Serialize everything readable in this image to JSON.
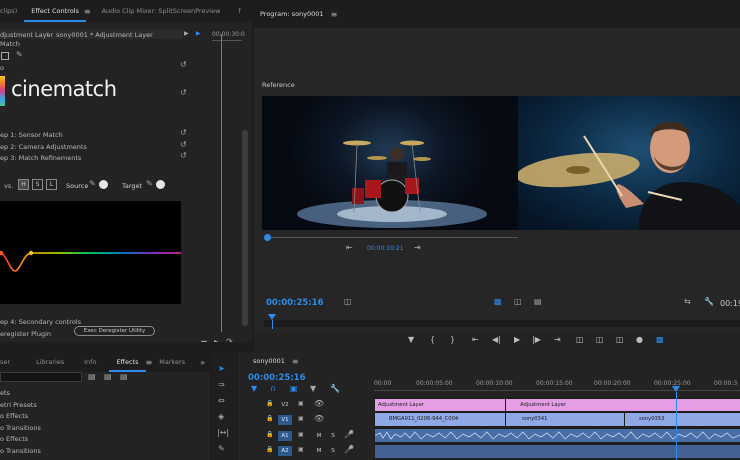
{
  "source_panel": {
    "tab_clips": "clips)",
    "tab_effect_controls": "Effect Controls",
    "tab_audio_mixer": "Audio Clip Mixer: SplitScreenPreview",
    "tab_more": "f",
    "breadcrumb_source": "djustment Layer",
    "breadcrumb_clip": "sony0001 * Adjustment Layer",
    "ruler_time": "00:00:30:0",
    "effect_match_label": "Match",
    "fx_prefix": "o",
    "logo_text": "cinematch",
    "step1": "ep 1: Sensor Match",
    "step2": "ep 2: Camera Adjustments",
    "step3": "ep 3: Match Refinements",
    "vs_label": "vs.",
    "hsl": [
      "H",
      "S",
      "L"
    ],
    "source_label": "Source",
    "target_label": "Target",
    "step4": "ep 4: Secondary controls",
    "deregister_label": "eregister Plugin",
    "exec_button": "Exec Deregister Utility"
  },
  "program_panel": {
    "title": "Program: sony0001",
    "reference_label": "Reference",
    "ref_timecode": "00:00:10:21",
    "timecode": "00:00:25:16",
    "right_timecode": "00:19"
  },
  "effects_panel": {
    "tabs": [
      "ser",
      "Libraries",
      "Info",
      "Effects",
      "Markers"
    ],
    "active_tab": "Effects",
    "items": [
      "ets",
      "etri Presets",
      "o Effects",
      "o Transitions",
      "o Effects",
      "o Transitions"
    ]
  },
  "timeline": {
    "tab": "sony0001",
    "timecode": "00:00:25:16",
    "ruler": [
      "00:00",
      "00:00:05:00",
      "00:00:10:00",
      "00:00:15:00",
      "00:00:20:00",
      "00:00:25:00",
      "00:00:3"
    ],
    "tracks": [
      "V2",
      "V1",
      "A1",
      "A2"
    ],
    "track_buttons": {
      "m": "M",
      "s": "S"
    },
    "clips": {
      "adj1": "Adjustment Layer",
      "adj2": "Adjustment Layer",
      "v1a": "BMGA011_0206-944_C004",
      "v1b": "sony0341",
      "v1c": "sony0353"
    }
  },
  "colors": {
    "accent": "#2d8ceb",
    "adjustment_clip": "#e59ee6",
    "video_clip": "#8fa9e6",
    "audio_clip": "#6d94d1"
  }
}
